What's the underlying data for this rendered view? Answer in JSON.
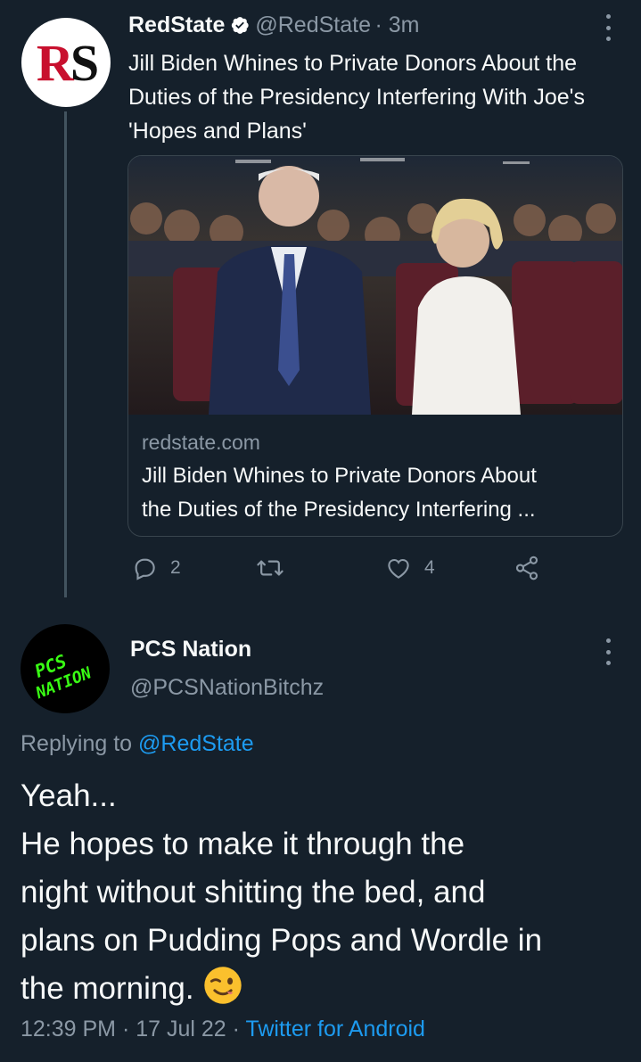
{
  "tweet1": {
    "author_name": "RedState",
    "author_handle": "@RedState",
    "time_ago": "· 3m",
    "avatar_text_r": "R",
    "avatar_text_s": "S",
    "text": "Jill Biden Whines to Private Donors About the Duties of the Presidency Interfering With Joe's 'Hopes and Plans'",
    "card": {
      "domain": "redstate.com",
      "title_line1": "Jill Biden Whines to Private Donors About",
      "title_line2": "the Duties of the Presidency Interfering ..."
    },
    "actions": {
      "reply_count": "2",
      "retweet_count": "",
      "like_count": "4"
    }
  },
  "tweet2": {
    "author_name": "PCS Nation",
    "author_handle": "@PCSNationBitchz",
    "avatar_line1": "PCS",
    "avatar_line2": "NATION",
    "replying_prefix": "Replying to ",
    "replying_handle": "@RedState",
    "text_lines": [
      "Yeah...",
      "He hopes to make it through the",
      "night without shitting the bed, and",
      "plans on Pudding Pops and Wordle in",
      "the morning."
    ],
    "timestamp": "12:39 PM · 17 Jul 22 · ",
    "source": "Twitter for Android"
  },
  "colors": {
    "background": "#15202b",
    "accent": "#1d9bf0",
    "secondary_text": "#8b98a5",
    "avatar_neon": "#39ff14"
  }
}
